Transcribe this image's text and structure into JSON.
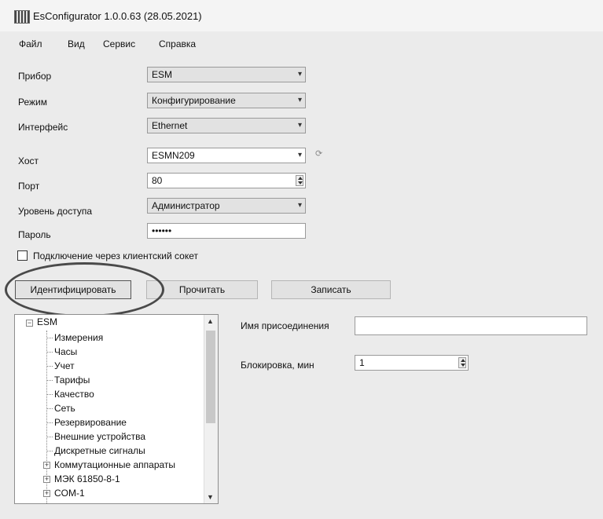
{
  "window": {
    "title": "EsConfigurator 1.0.0.63 (28.05.2021)"
  },
  "menu": {
    "items": [
      "Файл",
      "Вид",
      "Сервис",
      "Справка"
    ]
  },
  "form": {
    "device_label": "Прибор",
    "device_value": "ESM",
    "mode_label": "Режим",
    "mode_value": "Конфигурирование",
    "interface_label": "Интерфейс",
    "interface_value": "Ethernet",
    "host_label": "Хост",
    "host_value": "ESMN209",
    "port_label": "Порт",
    "port_value": "80",
    "access_label": "Уровень доступа",
    "access_value": "Администратор",
    "password_label": "Пароль",
    "password_value": "••••••",
    "socket_label": "Подключение через клиентский сокет"
  },
  "buttons": {
    "identify": "Идентифицировать",
    "read": "Прочитать",
    "write": "Записать"
  },
  "tree": {
    "root": "ESM",
    "items": [
      "Измерения",
      "Часы",
      "Учет",
      "Тарифы",
      "Качество",
      "Сеть",
      "Резервирование",
      "Внешние устройства",
      "Дискретные сигналы"
    ],
    "expandable": [
      "Коммутационные аппараты",
      "МЭК 61850-8-1",
      "COM-1"
    ]
  },
  "details": {
    "connection_name_label": "Имя присоединения",
    "connection_name_value": "",
    "lock_label": "Блокировка, мин",
    "lock_value": "1"
  }
}
